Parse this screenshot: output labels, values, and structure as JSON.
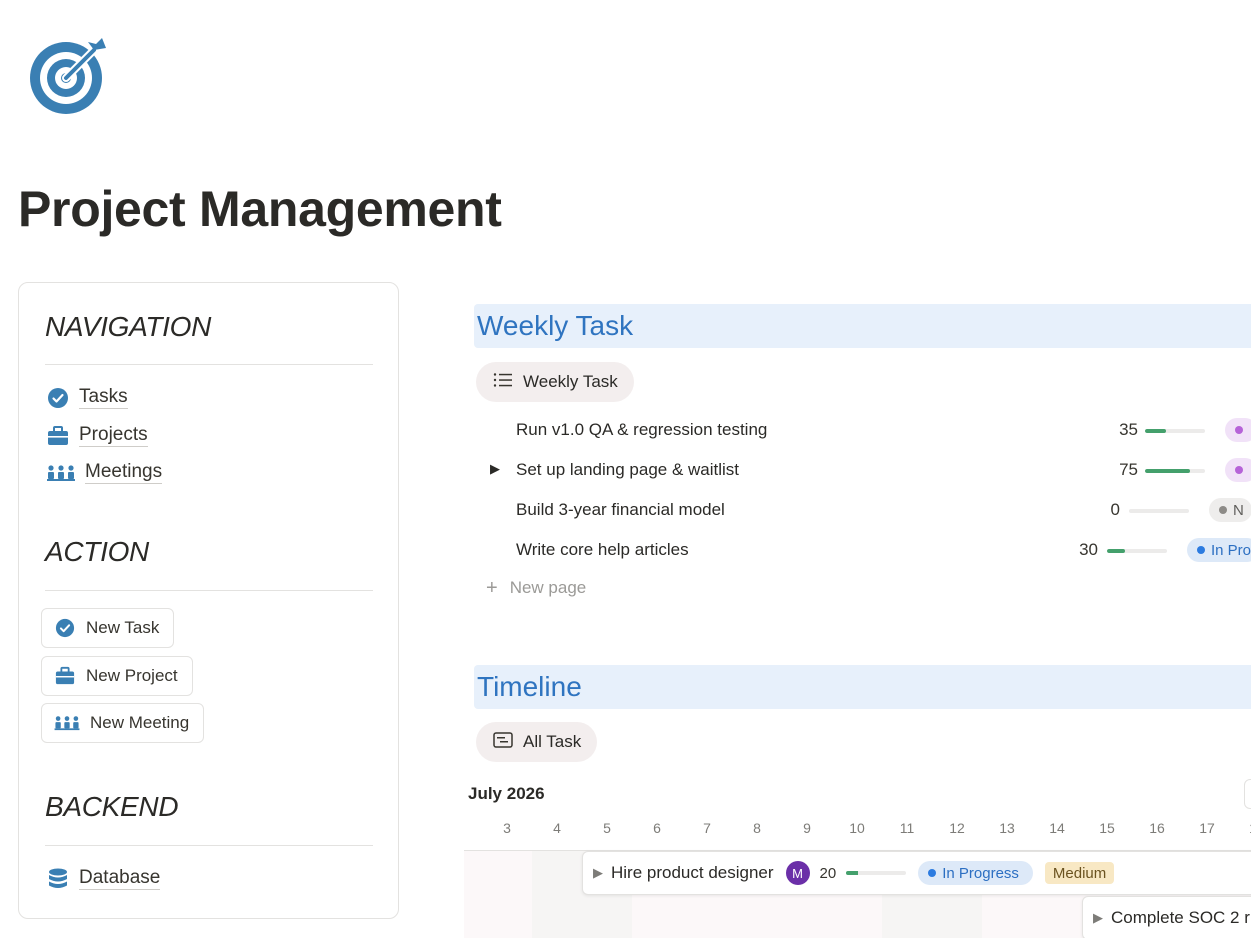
{
  "page": {
    "title": "Project Management",
    "icon": "target-icon",
    "accent": "#3a7fb3"
  },
  "sidebar": {
    "navigation": {
      "heading": "NAVIGATION",
      "items": [
        {
          "label": "Tasks",
          "icon": "check-circle-icon"
        },
        {
          "label": "Projects",
          "icon": "briefcase-icon"
        },
        {
          "label": "Meetings",
          "icon": "people-icon"
        }
      ]
    },
    "action": {
      "heading": "ACTION",
      "buttons": [
        {
          "label": "New Task",
          "icon": "check-circle-icon"
        },
        {
          "label": "New Project",
          "icon": "briefcase-icon"
        },
        {
          "label": "New Meeting",
          "icon": "people-icon"
        }
      ]
    },
    "backend": {
      "heading": "BACKEND",
      "items": [
        {
          "label": "Database",
          "icon": "database-icon"
        }
      ]
    }
  },
  "weekly": {
    "heading": "Weekly Task",
    "view_tab": "Weekly Task",
    "rows": [
      {
        "name": "Run v1.0 QA & regression testing",
        "progress": 35,
        "has_children": false,
        "status": ""
      },
      {
        "name": "Set up landing page & waitlist",
        "progress": 75,
        "has_children": true,
        "status": ""
      },
      {
        "name": "Build 3-year financial model",
        "progress": 0,
        "has_children": false,
        "status": "N"
      },
      {
        "name": "Write core help articles",
        "progress": 30,
        "has_children": false,
        "status": "In Pro"
      }
    ],
    "new_page": "New page"
  },
  "timeline": {
    "heading": "Timeline",
    "view_tab": "All Task",
    "month": "July 2026",
    "days": [
      "3",
      "4",
      "5",
      "6",
      "7",
      "8",
      "9",
      "10",
      "11",
      "12",
      "13",
      "14",
      "15",
      "16",
      "17",
      "1"
    ],
    "cards": [
      {
        "name": "Hire product designer",
        "avatar": "M",
        "progress": 20,
        "status": "In Progress",
        "priority": "Medium"
      },
      {
        "name": "Complete SOC 2 r"
      }
    ]
  },
  "colors": {
    "status_purple_bg": "#f1e2f8",
    "status_purple_dot": "#b663d8",
    "status_gray_bg": "#eeedec",
    "status_gray_dot": "#8d8b87",
    "status_blue_bg": "#dde9f8",
    "status_blue_dot": "#2c7be0",
    "priority_medium_bg": "#f8e8c4",
    "progress_green": "#44a06c"
  }
}
